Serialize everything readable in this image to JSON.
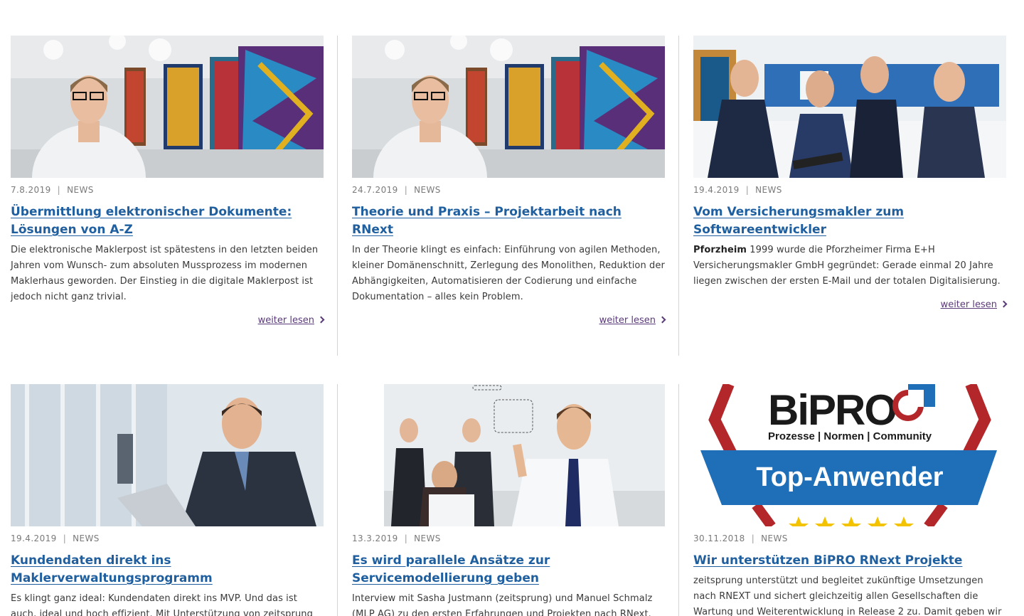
{
  "cards": [
    {
      "date": "7.8.2019",
      "category": "NEWS",
      "title": "Übermittlung elektronischer Dokumente: Lösungen von A-Z",
      "excerpt": "Die elektronische Maklerpost ist spätestens in den letzten beiden Jahren vom Wunsch- zum absoluten Mussprozess im modernen Maklerhaus geworden. Der Einstieg in die digitale Maklerpost ist jedoch nicht ganz trivial.",
      "more": "weiter lesen"
    },
    {
      "date": "24.7.2019",
      "category": "NEWS",
      "title": "Theorie und Praxis – Projektarbeit nach RNext",
      "excerpt": "In der Theorie klingt es einfach: Einführung von agilen Methoden, kleiner Domänenschnitt, Zerlegung des Monolithen, Reduktion der Abhängigkeiten, Automatisieren der Codierung und einfache Dokumentation – alles kein Problem.",
      "more": "weiter lesen"
    },
    {
      "date": "19.4.2019",
      "category": "NEWS",
      "title": "Vom Versicherungsmakler zum Softwareentwickler",
      "excerpt_bold": "Pforzheim",
      "excerpt": " 1999 wurde die Pforzheimer Firma E+H Versicherungsmakler GmbH gegründet: Gerade einmal 20 Jahre liegen zwischen der ersten E-Mail und der totalen Digitalisierung.",
      "more": "weiter lesen"
    },
    {
      "date": "19.4.2019",
      "category": "NEWS",
      "title": "Kundendaten direkt ins Maklerverwaltungsprogramm",
      "excerpt": "Es klingt ganz ideal: Kundendaten direkt ins MVP. Und das ist auch, ideal und hoch effizient. Mit Unterstützung von zeitsprung"
    },
    {
      "date": "13.3.2019",
      "category": "NEWS",
      "title": "Es wird parallele Ansätze zur Servicemodellierung geben",
      "excerpt": "Interview mit Sasha Justmann (zeitsprung) und Manuel Schmalz (MLP AG) zu den ersten Erfahrungen und Projekten nach RNext."
    },
    {
      "date": "30.11.2018",
      "category": "NEWS",
      "title": "Wir unterstützen BiPRO RNext Projekte",
      "excerpt": "zeitsprung unterstützt und begleitet zukünftige Umsetzungen nach RNEXT und sichert gleichzeitig allen Gesellschaften die Wartung und Weiterentwicklung in Release 2 zu. Damit geben wir"
    }
  ],
  "bipro_logo": {
    "brand": "BiPRO",
    "tagline": "Prozesse | Normen | Community",
    "badge": "Top-Anwender"
  },
  "colors": {
    "link": "#1f5f9f",
    "more_link": "#5b3a7a",
    "meta": "#7a7a7a",
    "bipro_blue": "#1f6fb8",
    "bipro_red": "#b3262a",
    "star": "#f3c300"
  }
}
